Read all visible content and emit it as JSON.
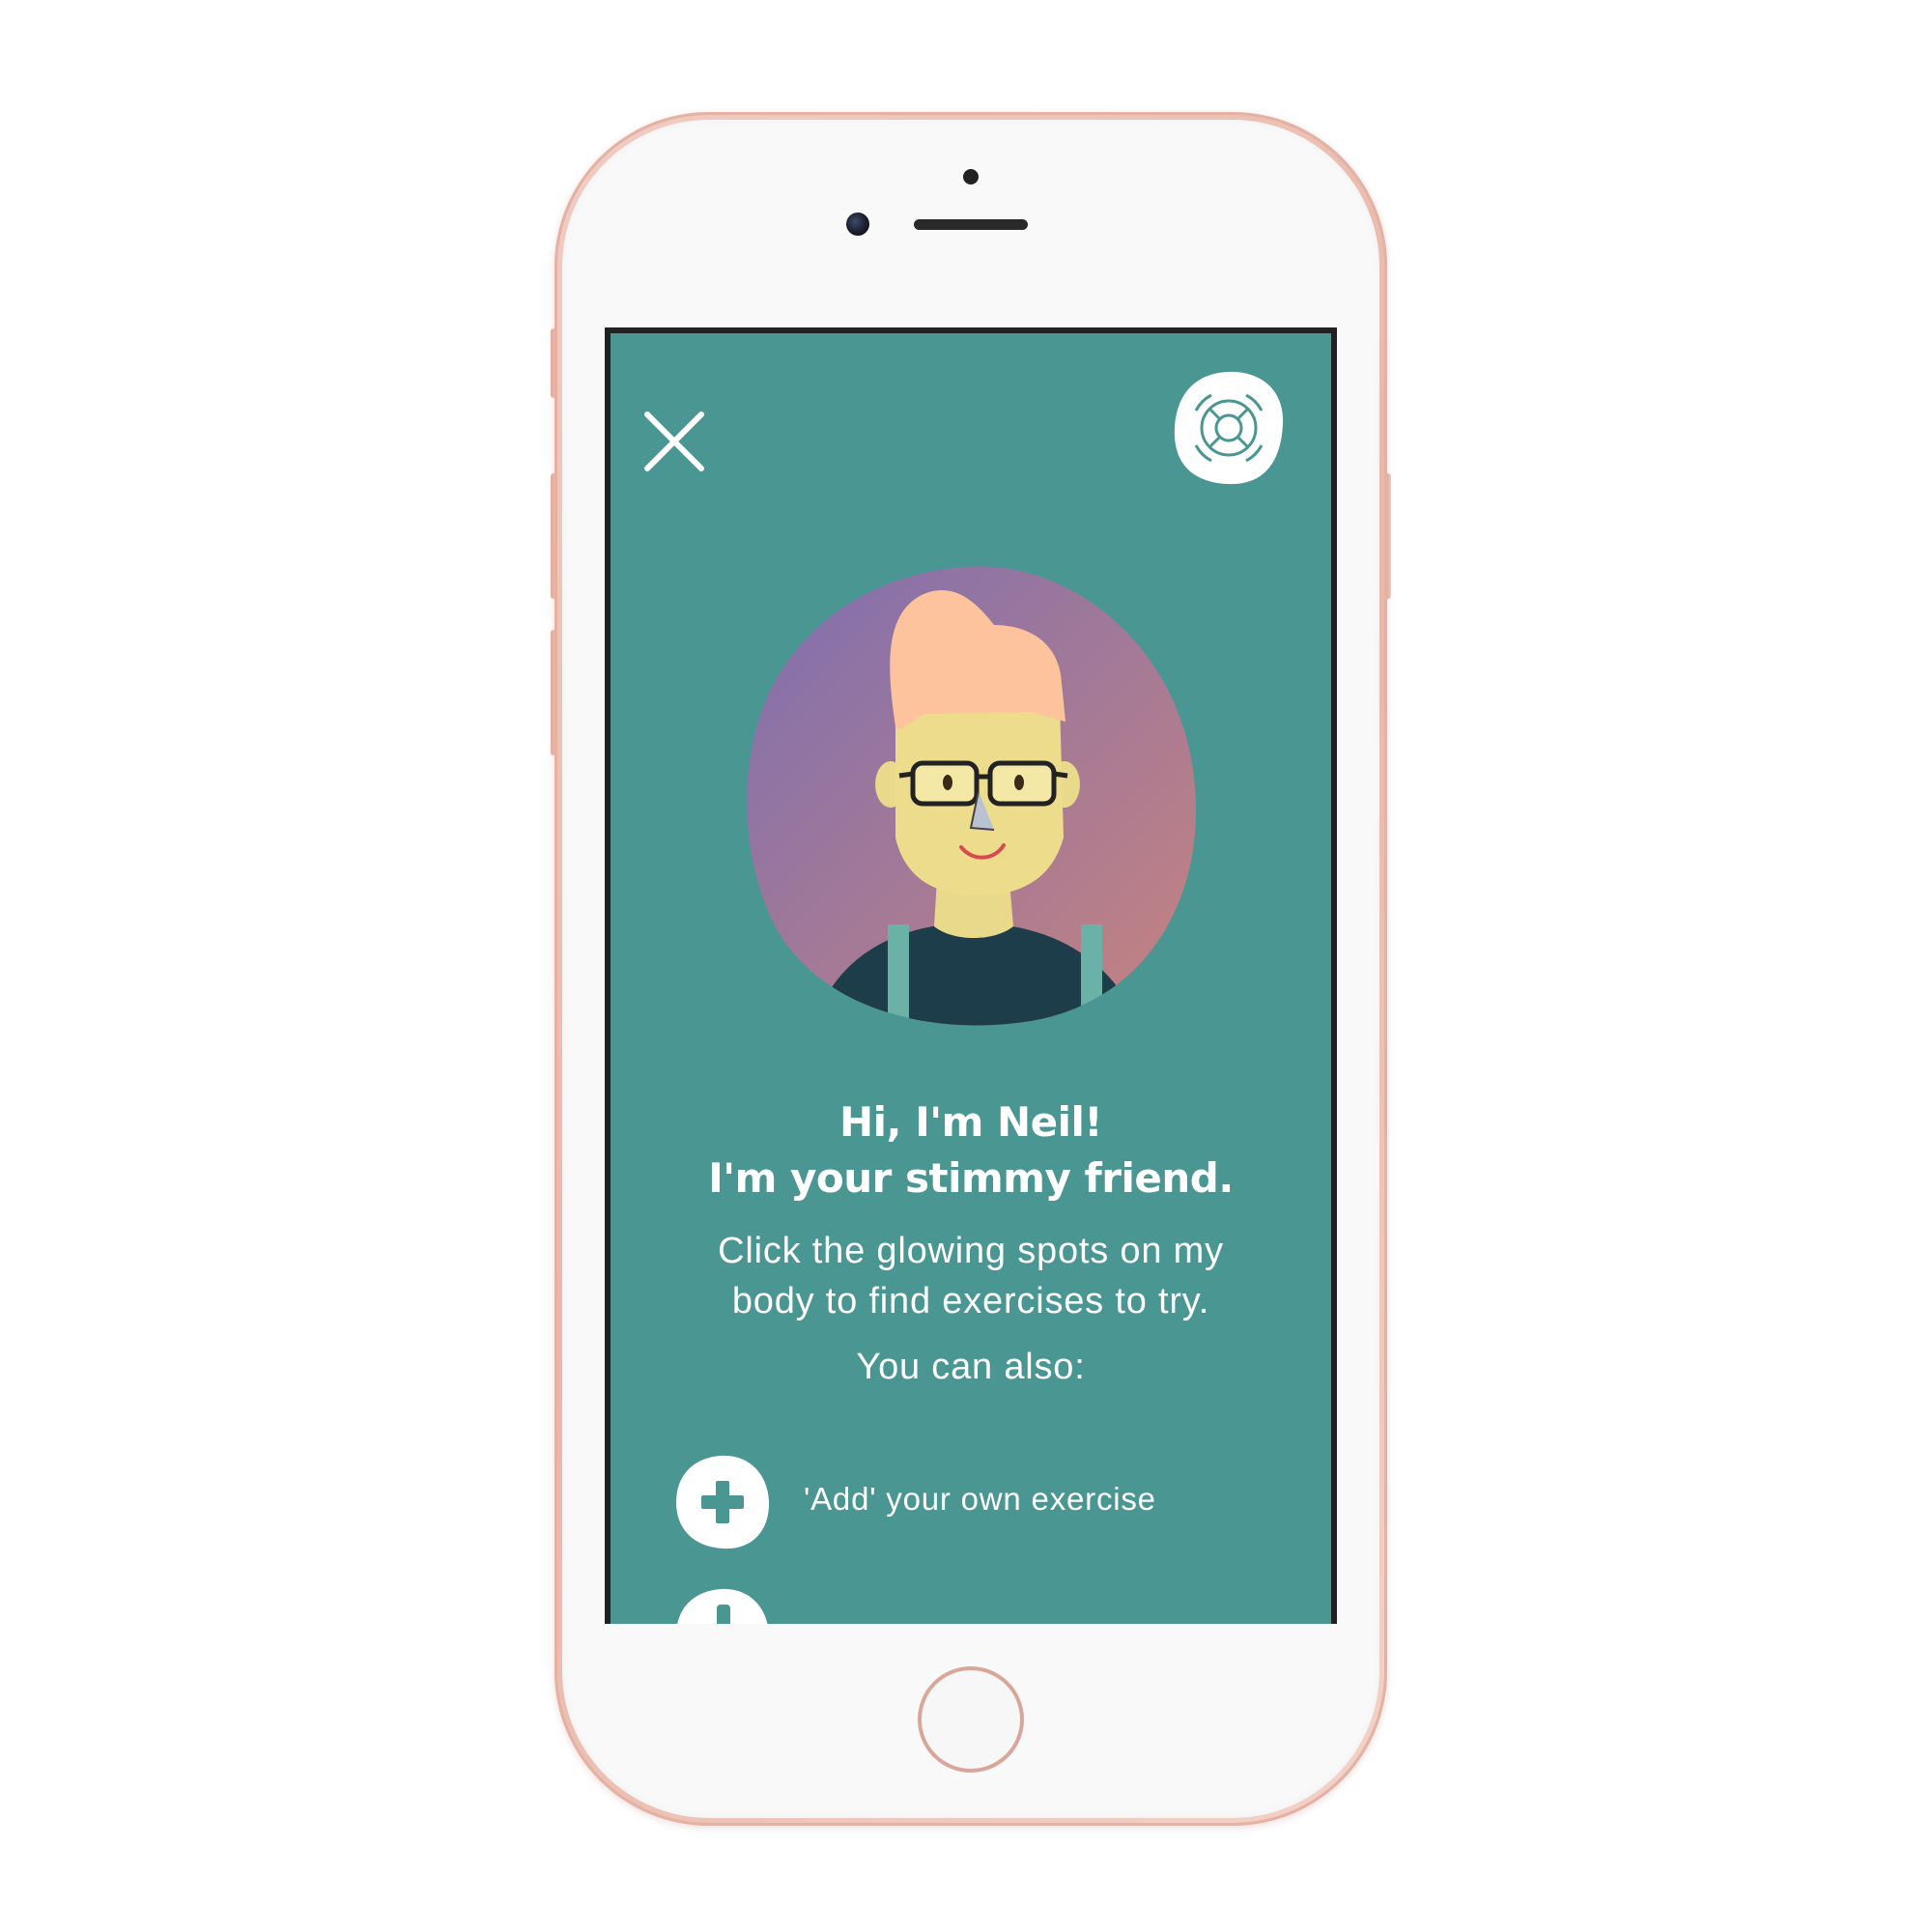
{
  "screen": {
    "background_color": "#4a9692",
    "close_icon": "close-icon",
    "help_icon": "lifebuoy-icon"
  },
  "character": {
    "name": "Neil",
    "headline_line1": "Hi, I'm Neil!",
    "headline_line2": "I'm your stimmy friend."
  },
  "instructions": {
    "line1": "Click the glowing spots on my",
    "line2": "body to find exercises to try.",
    "also": "You can also:"
  },
  "actions": [
    {
      "icon": "plus-icon",
      "label": "'Add' your own exercise"
    },
    {
      "icon": "more-icon",
      "label": ""
    }
  ],
  "colors": {
    "accent": "#4a9692",
    "white": "#ffffff",
    "phone_frame": "#e8b7a9"
  }
}
